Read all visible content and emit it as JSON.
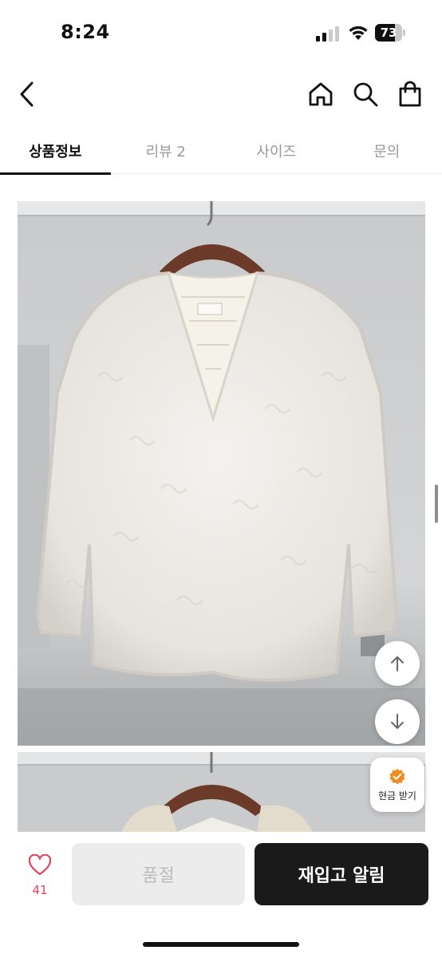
{
  "status_bar": {
    "time": "8:24",
    "battery_level": "73",
    "battery_fill_fraction": 0.73
  },
  "header": {
    "back_icon": "chevron-left-icon",
    "home_icon": "home-icon",
    "search_icon": "search-icon",
    "bag_icon": "shopping-bag-icon"
  },
  "tabs": [
    {
      "label": "상품정보",
      "active": true
    },
    {
      "label": "리뷰 2",
      "active": false
    },
    {
      "label": "사이즈",
      "active": false
    },
    {
      "label": "문의",
      "active": false
    }
  ],
  "floating": {
    "up_icon": "arrow-up-icon",
    "down_icon": "arrow-down-icon",
    "cash_icon": "badge-check-icon",
    "cash_label": "현금 받기",
    "cash_color": "#f08c1e"
  },
  "bottom_bar": {
    "like_icon": "heart-icon",
    "like_count": "41",
    "like_color": "#e0455e",
    "soldout_label": "품절",
    "restock_label": "재입고 알림"
  }
}
